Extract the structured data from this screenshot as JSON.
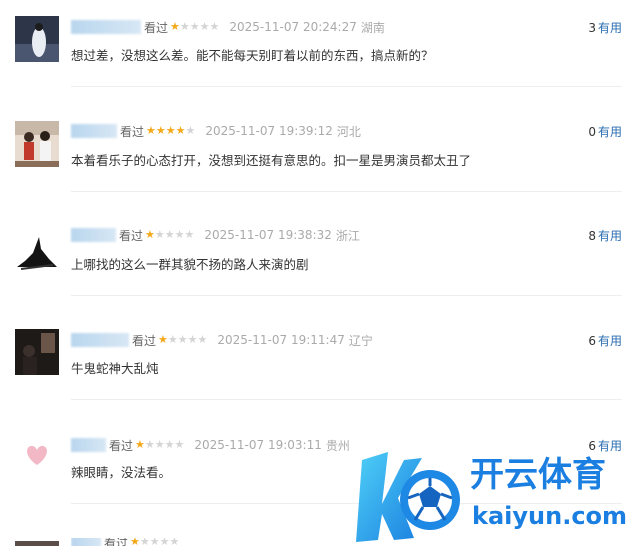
{
  "colors": {
    "star": "#f3a91a",
    "star_empty": "#d4d4d4",
    "link": "#2a6db0",
    "text": "#333333",
    "meta": "#aaaaaa"
  },
  "comments": [
    {
      "name_suffix": "看过",
      "rating": 1,
      "time": "2025-11-07 20:24:27",
      "location": "湖南",
      "useful_count": "3",
      "useful_label": "有用",
      "content": "想过差，没想这么差。能不能每天别盯着以前的东西，搞点新的？"
    },
    {
      "name_suffix": "看过",
      "rating": 4,
      "time": "2025-11-07 19:39:12",
      "location": "河北",
      "useful_count": "0",
      "useful_label": "有用",
      "content": "本着看乐子的心态打开，没想到还挺有意思的。扣一星是男演员都太丑了"
    },
    {
      "name_suffix": "看过",
      "rating": 1,
      "time": "2025-11-07 19:38:32",
      "location": "浙江",
      "useful_count": "8",
      "useful_label": "有用",
      "content": "上哪找的这么一群其貌不扬的路人来演的剧"
    },
    {
      "name_suffix": "看过",
      "rating": 1,
      "time": "2025-11-07 19:11:47",
      "location": "辽宁",
      "useful_count": "6",
      "useful_label": "有用",
      "content": "牛鬼蛇神大乱炖"
    },
    {
      "name_suffix": "看过",
      "rating": 1,
      "time": "2025-11-07 19:03:11",
      "location": "贵州",
      "useful_count": "6",
      "useful_label": "有用",
      "content": "辣眼睛，没法看。"
    },
    {
      "name_suffix": "看过",
      "rating": 1,
      "time": "",
      "location": "",
      "useful_count": "",
      "useful_label": "",
      "content": ""
    }
  ],
  "watermark": {
    "brand": "开云体育",
    "url": "kaiyun.com",
    "logo_letter": "K"
  }
}
